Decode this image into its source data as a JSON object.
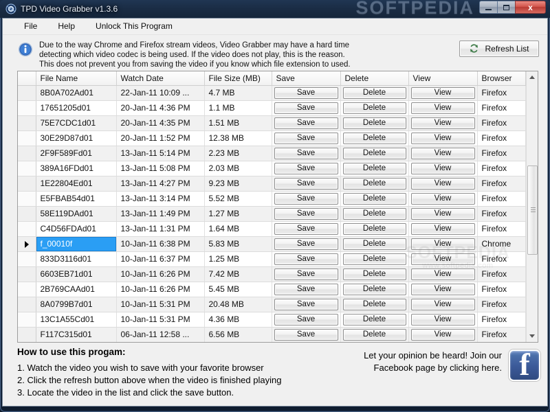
{
  "window": {
    "title": "TPD Video Grabber v1.3.6",
    "app_icon": "app-icon",
    "watermark": "SOFTPEDIA",
    "buttons": {
      "minimize": "minimize",
      "maximize": "maximize",
      "close": "x"
    }
  },
  "menu": {
    "items": [
      {
        "label": "File"
      },
      {
        "label": "Help"
      },
      {
        "label": "Unlock This Program"
      }
    ]
  },
  "banner": {
    "icon": "info-icon",
    "lines": [
      "Due to the way Chrome and Firefox stream videos, Video Grabber may have a hard time",
      "detecting which video codec is being used. If the video does not play, this is the reason.",
      "This does not prevent you from saving the video if you know which file extension to used."
    ],
    "refresh_label": "Refresh List",
    "refresh_icon": "refresh-icon"
  },
  "grid": {
    "columns": [
      "File Name",
      "Watch Date",
      "File Size (MB)",
      "Save",
      "Delete",
      "View",
      "Browser"
    ],
    "action_labels": {
      "save": "Save",
      "delete": "Delete",
      "view": "View"
    },
    "selected_row_index": 10,
    "rows": [
      {
        "file_name": "8B0A702Ad01",
        "watch_date": "22-Jan-11 10:09 ...",
        "file_size": "4.7 MB",
        "browser": "Firefox"
      },
      {
        "file_name": "17651205d01",
        "watch_date": "20-Jan-11 4:36 PM",
        "file_size": "1.1 MB",
        "browser": "Firefox"
      },
      {
        "file_name": "75E7CDC1d01",
        "watch_date": "20-Jan-11 4:35 PM",
        "file_size": "1.51 MB",
        "browser": "Firefox"
      },
      {
        "file_name": "30E29D87d01",
        "watch_date": "20-Jan-11 1:52 PM",
        "file_size": "12.38 MB",
        "browser": "Firefox"
      },
      {
        "file_name": "2F9F589Fd01",
        "watch_date": "13-Jan-11 5:14 PM",
        "file_size": "2.23 MB",
        "browser": "Firefox"
      },
      {
        "file_name": "389A16FDd01",
        "watch_date": "13-Jan-11 5:08 PM",
        "file_size": "2.03 MB",
        "browser": "Firefox"
      },
      {
        "file_name": "1E22804Ed01",
        "watch_date": "13-Jan-11 4:27 PM",
        "file_size": "9.23 MB",
        "browser": "Firefox"
      },
      {
        "file_name": "E5FBAB54d01",
        "watch_date": "13-Jan-11 3:14 PM",
        "file_size": "5.52 MB",
        "browser": "Firefox"
      },
      {
        "file_name": "58E119DAd01",
        "watch_date": "13-Jan-11 1:49 PM",
        "file_size": "1.27 MB",
        "browser": "Firefox"
      },
      {
        "file_name": "C4D56FDAd01",
        "watch_date": "13-Jan-11 1:31 PM",
        "file_size": "1.64 MB",
        "browser": "Firefox"
      },
      {
        "file_name": "f_00010f",
        "watch_date": "10-Jan-11 6:38 PM",
        "file_size": "5.83 MB",
        "browser": "Chrome"
      },
      {
        "file_name": "833D3116d01",
        "watch_date": "10-Jan-11 6:37 PM",
        "file_size": "1.25 MB",
        "browser": "Firefox"
      },
      {
        "file_name": "6603EB71d01",
        "watch_date": "10-Jan-11 6:26 PM",
        "file_size": "7.42 MB",
        "browser": "Firefox"
      },
      {
        "file_name": "2B769CAAd01",
        "watch_date": "10-Jan-11 6:26 PM",
        "file_size": "5.45 MB",
        "browser": "Firefox"
      },
      {
        "file_name": "8A0799B7d01",
        "watch_date": "10-Jan-11 5:31 PM",
        "file_size": "20.48 MB",
        "browser": "Firefox"
      },
      {
        "file_name": "13C1A55Cd01",
        "watch_date": "10-Jan-11 5:31 PM",
        "file_size": "4.36 MB",
        "browser": "Firefox"
      },
      {
        "file_name": "F117C315d01",
        "watch_date": "06-Jan-11 12:58 ...",
        "file_size": "6.56 MB",
        "browser": "Firefox"
      }
    ],
    "watermark_line1": "SOFTPEDIA",
    "watermark_line2": "www.softpedia.com"
  },
  "help": {
    "title": "How to use this progam:",
    "steps": [
      "1. Watch the video you wish to save with your favorite browser",
      "2. Click the refresh button above when the video is finished playing",
      "3. Locate the video in the list and click the save button."
    ]
  },
  "facebook": {
    "line1": "Let your opinion be heard! Join our",
    "line2": "Facebook page by clicking here.",
    "logo_glyph": "f",
    "logo_color": "#3b5998"
  }
}
